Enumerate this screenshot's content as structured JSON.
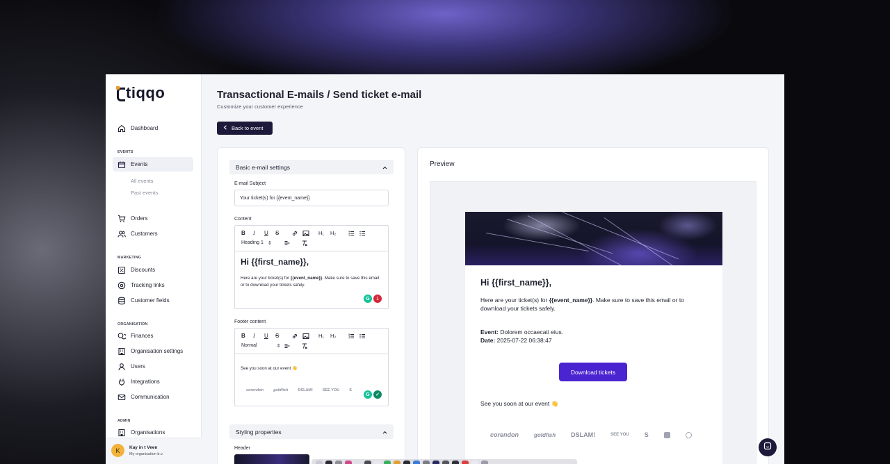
{
  "app": {
    "logo_text": "tiqqo"
  },
  "sidebar": {
    "dashboard": "Dashboard",
    "events_section": "EVENTS",
    "events": "Events",
    "all_events": "All events",
    "past_events": "Past events",
    "orders": "Orders",
    "customers": "Customers",
    "marketing_section": "MARKETING",
    "discounts": "Discounts",
    "tracking_links": "Tracking links",
    "customer_fields": "Customer fields",
    "organisation_section": "ORGANISATION",
    "finances": "Finances",
    "organisation_settings": "Organisation settings",
    "users": "Users",
    "integrations": "Integrations",
    "communication": "Communication",
    "admin_section": "ADMIN",
    "organisations": "Organisations"
  },
  "user": {
    "initial": "K",
    "name": "Kay in t Veen",
    "org": "My organisation b.v."
  },
  "header": {
    "title": "Transactional E-mails / Send ticket e-mail",
    "subtitle": "Customize your customer experience",
    "back_label": "Back to event"
  },
  "settings": {
    "basic_title": "Basic e-mail settings",
    "subject_label": "E-mail Subject",
    "subject_value": "Your ticket(s) for {{event_name}}",
    "content_label": "Content",
    "content_heading_select": "Heading 1",
    "content_h1": "Hi {{first_name}},",
    "content_p_start": "Here are your ticket(s) for ",
    "content_p_bold": "{{event_name}}",
    "content_p_end": ". Make sure to save this email or to download your tickets safely.",
    "grammarly_count": "1",
    "footer_label": "Footer content",
    "footer_select": "Normal",
    "footer_text": "See you soon at our event 👋",
    "styling_title": "Styling properties",
    "header_label": "Header"
  },
  "toolbar": {
    "bold": "B",
    "italic": "I",
    "underline": "U",
    "strike": "S",
    "h1": "H₁",
    "h2": "H₂"
  },
  "partner_logos": [
    "corendon",
    "goldfish",
    "DSLAM!",
    "SEE YOU",
    "S",
    "",
    ""
  ],
  "preview": {
    "title": "Preview",
    "greeting": "Hi {{first_name}},",
    "intro_start": "Here are your ticket(s) for ",
    "intro_bold": "{{event_name}}",
    "intro_end": ". Make sure to save this email or to download your tickets safely.",
    "event_label": "Event:",
    "event_value": "Dolorem occaecati eius.",
    "date_label": "Date:",
    "date_value": "2025-07-22 06:38:47",
    "download_label": "Download tickets",
    "footer_text": "See you soon at our event 👋"
  },
  "colors": {
    "primary": "#1b1a3a",
    "accent": "#4a24d0",
    "logo_dot": "#f29a2e",
    "avatar": "#f1b33a"
  }
}
